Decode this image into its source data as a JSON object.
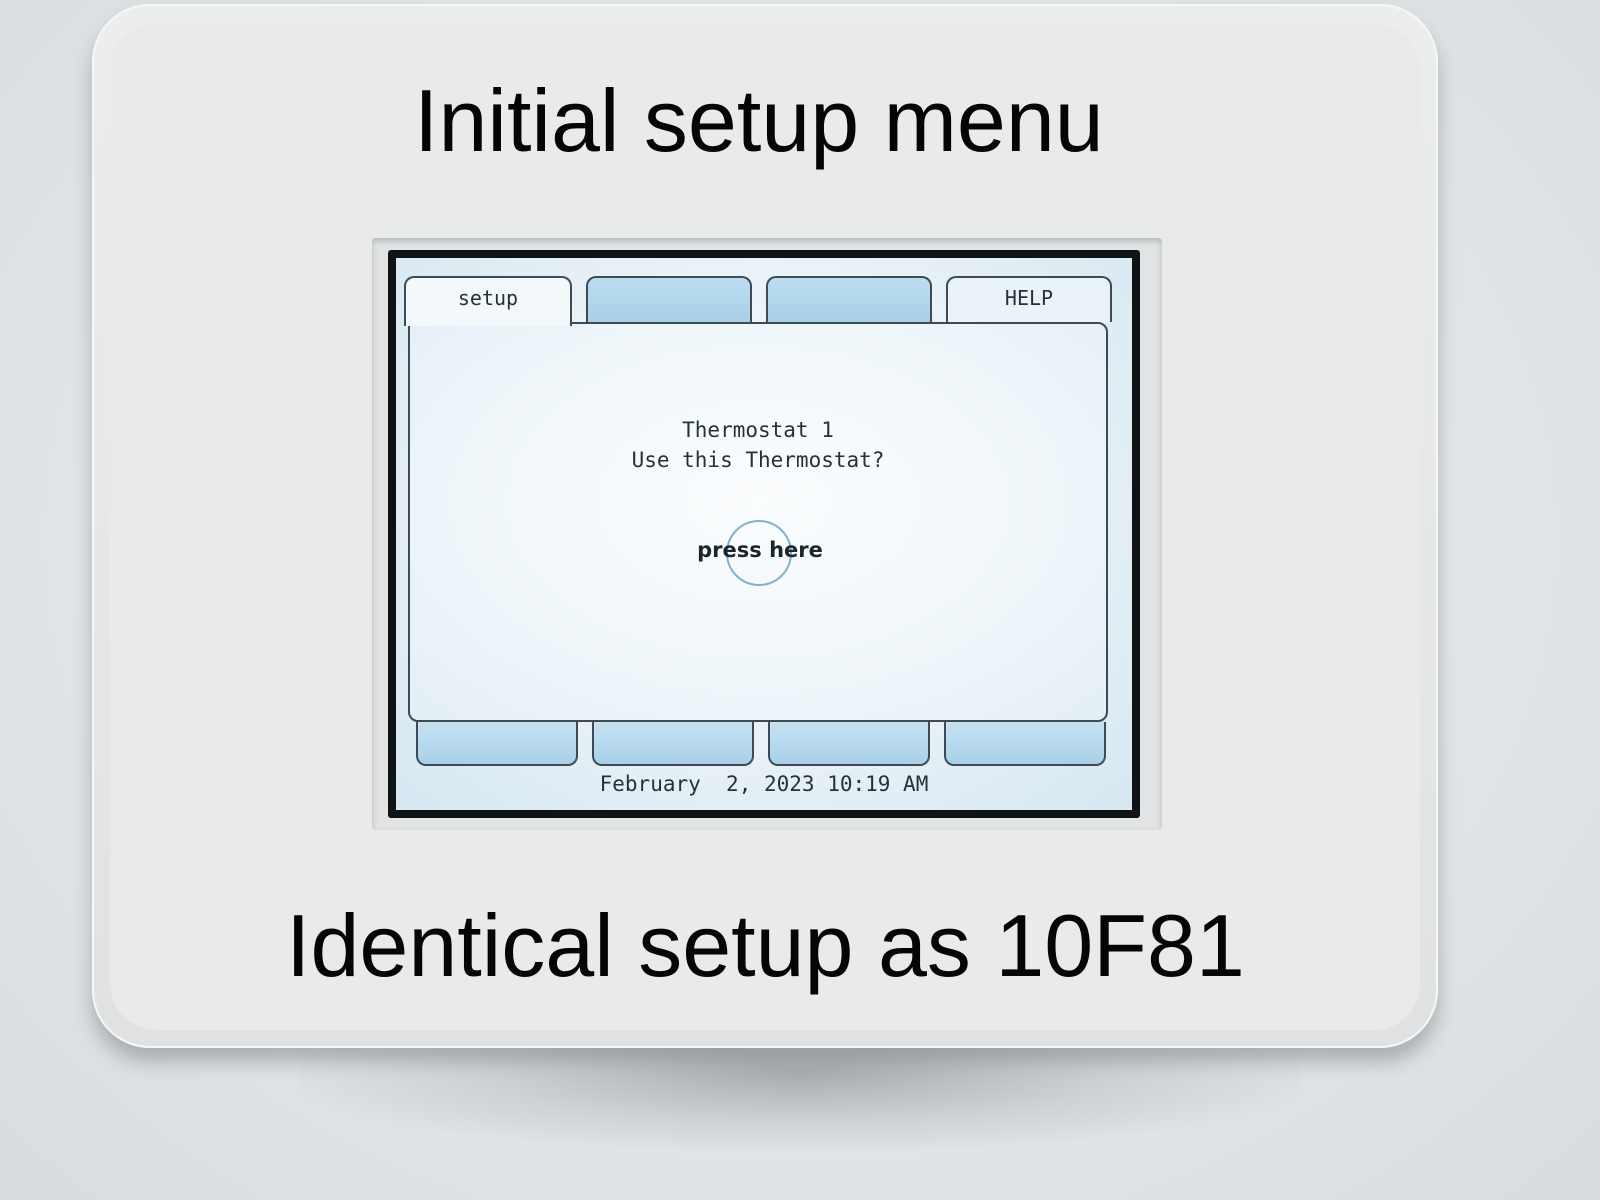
{
  "captions": {
    "top": "Initial setup menu",
    "bottom": "Identical setup as 10F81"
  },
  "screen": {
    "tabs": [
      {
        "label": "setup",
        "active": true
      },
      {
        "label": "",
        "active": false
      },
      {
        "label": "",
        "active": false
      },
      {
        "label": "HELP",
        "active": false
      }
    ],
    "message": {
      "line1": "Thermostat 1",
      "line2": "Use this Thermostat?"
    },
    "press_button": {
      "label": "press here"
    },
    "bottom_buttons": [
      "",
      "",
      "",
      ""
    ],
    "status": {
      "datetime": "February  2, 2023 10:19 AM"
    }
  },
  "colors": {
    "tab_fill": "#a9d0e8",
    "lcd_background": "#eef5f9",
    "outline": "#3e4b55",
    "press_ring": "#7fb2d1"
  }
}
